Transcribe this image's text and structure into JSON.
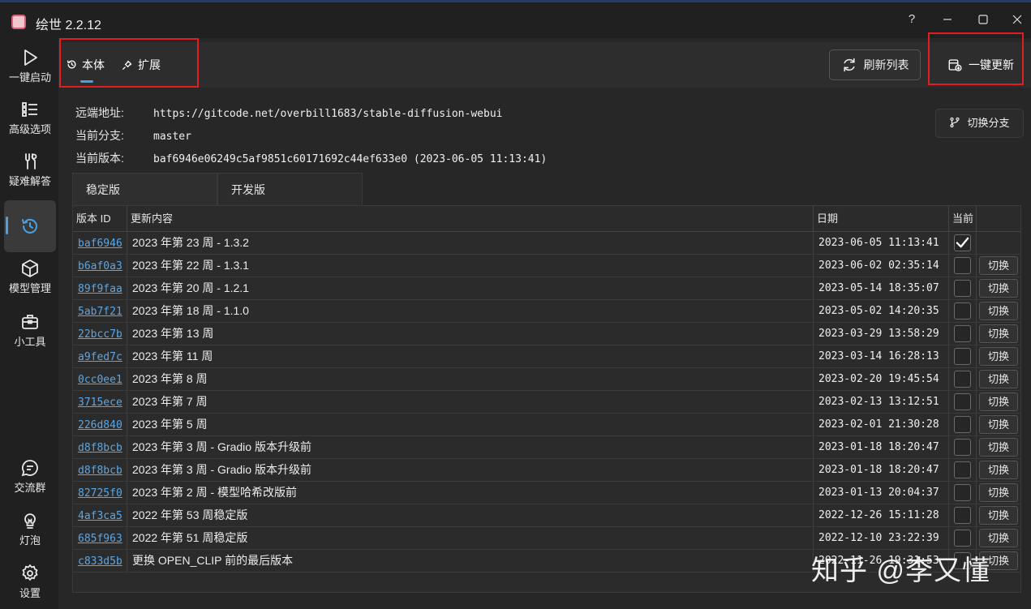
{
  "app": {
    "title": "绘世 2.2.12"
  },
  "window_controls": {
    "help": "?",
    "minimize": "—",
    "maximize": "☐",
    "close": "✕"
  },
  "sidebar": {
    "items": [
      {
        "label": "一键启动",
        "icon": "play-icon"
      },
      {
        "label": "高级选项",
        "icon": "list-icon"
      },
      {
        "label": "疑难解答",
        "icon": "tools-icon"
      },
      {
        "label": "",
        "icon": "history-icon",
        "active": true
      },
      {
        "label": "模型管理",
        "icon": "cube-icon"
      },
      {
        "label": "小工具",
        "icon": "toolbox-icon"
      },
      {
        "label": "交流群",
        "icon": "chat-icon"
      },
      {
        "label": "灯泡",
        "icon": "bulb-icon"
      },
      {
        "label": "设置",
        "icon": "gear-icon"
      }
    ]
  },
  "tabs": [
    {
      "label": "本体",
      "icon": "history-icon",
      "active": true
    },
    {
      "label": "扩展",
      "icon": "plugin-icon",
      "active": false
    }
  ],
  "toolbar": {
    "refresh_label": "刷新列表",
    "update_label": "一键更新",
    "switch_branch_label": "切换分支"
  },
  "repo": {
    "remote_label": "远端地址:",
    "remote_value": "https://gitcode.net/overbill1683/stable-diffusion-webui",
    "branch_label": "当前分支:",
    "branch_value": "master",
    "version_label": "当前版本:",
    "version_value": "baf6946e06249c5af9851c60171692c44ef633e0 (2023-06-05 11:13:41)"
  },
  "subtabs": [
    {
      "label": "稳定版",
      "active": true
    },
    {
      "label": "开发版",
      "active": false
    }
  ],
  "table": {
    "headers": {
      "id": "版本 ID",
      "desc": "更新内容",
      "date": "日期",
      "current": "当前"
    },
    "switch_label": "切换",
    "rows": [
      {
        "id": "baf6946",
        "desc": "2023 年第 23 周 - 1.3.2",
        "date": "2023-06-05 11:13:41",
        "current": true
      },
      {
        "id": "b6af0a3",
        "desc": "2023 年第 22 周 - 1.3.1",
        "date": "2023-06-02 02:35:14",
        "current": false
      },
      {
        "id": "89f9faa",
        "desc": "2023 年第 20 周 - 1.2.1",
        "date": "2023-05-14 18:35:07",
        "current": false
      },
      {
        "id": "5ab7f21",
        "desc": "2023 年第 18 周 - 1.1.0",
        "date": "2023-05-02 14:20:35",
        "current": false
      },
      {
        "id": "22bcc7b",
        "desc": "2023 年第 13 周",
        "date": "2023-03-29 13:58:29",
        "current": false
      },
      {
        "id": "a9fed7c",
        "desc": "2023 年第 11 周",
        "date": "2023-03-14 16:28:13",
        "current": false
      },
      {
        "id": "0cc0ee1",
        "desc": "2023 年第 8 周",
        "date": "2023-02-20 19:45:54",
        "current": false
      },
      {
        "id": "3715ece",
        "desc": "2023 年第 7 周",
        "date": "2023-02-13 13:12:51",
        "current": false
      },
      {
        "id": "226d840",
        "desc": "2023 年第 5 周",
        "date": "2023-02-01 21:30:28",
        "current": false
      },
      {
        "id": "d8f8bcb",
        "desc": "2023 年第 3 周 - Gradio 版本升级前",
        "date": "2023-01-18 18:20:47",
        "current": false
      },
      {
        "id": "d8f8bcb",
        "desc": "2023 年第 3 周 - Gradio 版本升级前",
        "date": "2023-01-18 18:20:47",
        "current": false
      },
      {
        "id": "82725f0",
        "desc": "2023 年第 2 周 - 模型哈希改版前",
        "date": "2023-01-13 20:04:37",
        "current": false
      },
      {
        "id": "4af3ca5",
        "desc": "2022 年第 53 周稳定版",
        "date": "2022-12-26 15:11:28",
        "current": false
      },
      {
        "id": "685f963",
        "desc": "2022 年第 51 周稳定版",
        "date": "2022-12-10 23:22:39",
        "current": false
      },
      {
        "id": "c833d5b",
        "desc": "更换 OPEN_CLIP 前的最后版本",
        "date": "2022-11-26 19:31:53",
        "current": false
      }
    ]
  },
  "watermark": "知乎 @李又懂",
  "colors": {
    "accent": "#4ca0e0",
    "link": "#5aa7e8",
    "highlight_box": "#e02020",
    "background": "#202020"
  }
}
